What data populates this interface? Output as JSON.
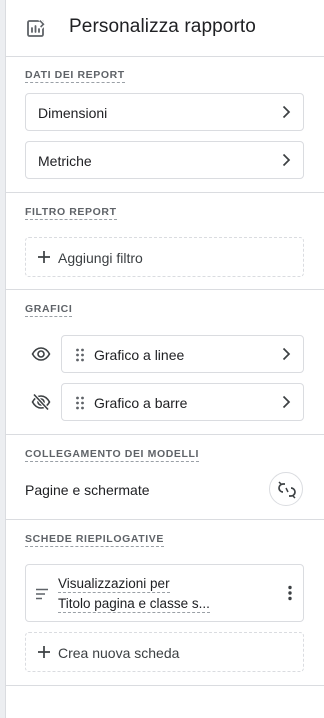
{
  "header": {
    "title": "Personalizza rapporto",
    "icon": "report-edit-icon"
  },
  "sections": {
    "report_data": {
      "label": "DATI DEI REPORT",
      "items": [
        {
          "label": "Dimensioni"
        },
        {
          "label": "Metriche"
        }
      ]
    },
    "report_filter": {
      "label": "FILTRO REPORT",
      "add_label": "Aggiungi filtro"
    },
    "charts": {
      "label": "GRAFICI",
      "items": [
        {
          "label": "Grafico a linee",
          "visibility_icon": "eye-icon"
        },
        {
          "label": "Grafico a barre",
          "visibility_icon": "eye-off-icon"
        }
      ]
    },
    "model_link": {
      "label": "COLLEGAMENTO DEI MODELLI",
      "value": "Pagine e schermate"
    },
    "summary_cards": {
      "label": "SCHEDE RIEPILOGATIVE",
      "card": {
        "line1": "Visualizzazioni per",
        "line2": "Titolo pagina e classe s..."
      },
      "add_label": "Crea nuova scheda"
    }
  },
  "colors": {
    "text": "#202124",
    "secondary": "#5f6368",
    "border": "#dadce0"
  }
}
